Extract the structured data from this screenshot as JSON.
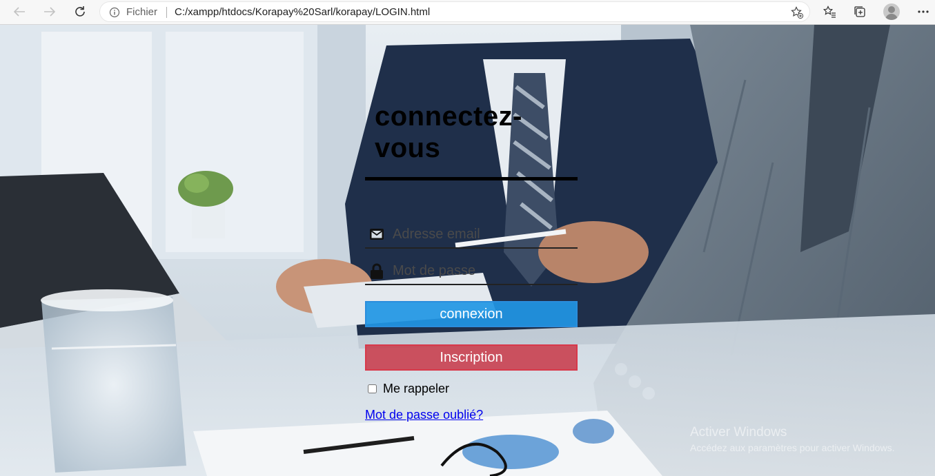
{
  "browser": {
    "scheme_label": "Fichier",
    "url": "C:/xampp/htdocs/Korapay%20Sarl/korapay/LOGIN.html",
    "icons": {
      "back": "arrow-left-icon",
      "forward": "arrow-right-icon",
      "refresh": "refresh-icon",
      "info": "info-icon",
      "add_favorite": "star-plus-icon",
      "favorites": "favorites-list-icon",
      "collections": "collections-icon",
      "profile": "avatar",
      "menu": "more-icon"
    }
  },
  "login": {
    "title": "connectez-vous",
    "email_placeholder": "Adresse email",
    "password_placeholder": "Mot de passe",
    "login_button": "connexion",
    "register_button": "Inscription",
    "remember_label": "Me rappeler",
    "forgot_link": "Mot de passe oublié?",
    "colors": {
      "login_button": "#2196e4",
      "register_button": "#c83746",
      "link": "#0000ee"
    }
  },
  "watermark": {
    "line1": "Activer Windows",
    "line2": "Accédez aux paramètres pour activer Windows."
  }
}
